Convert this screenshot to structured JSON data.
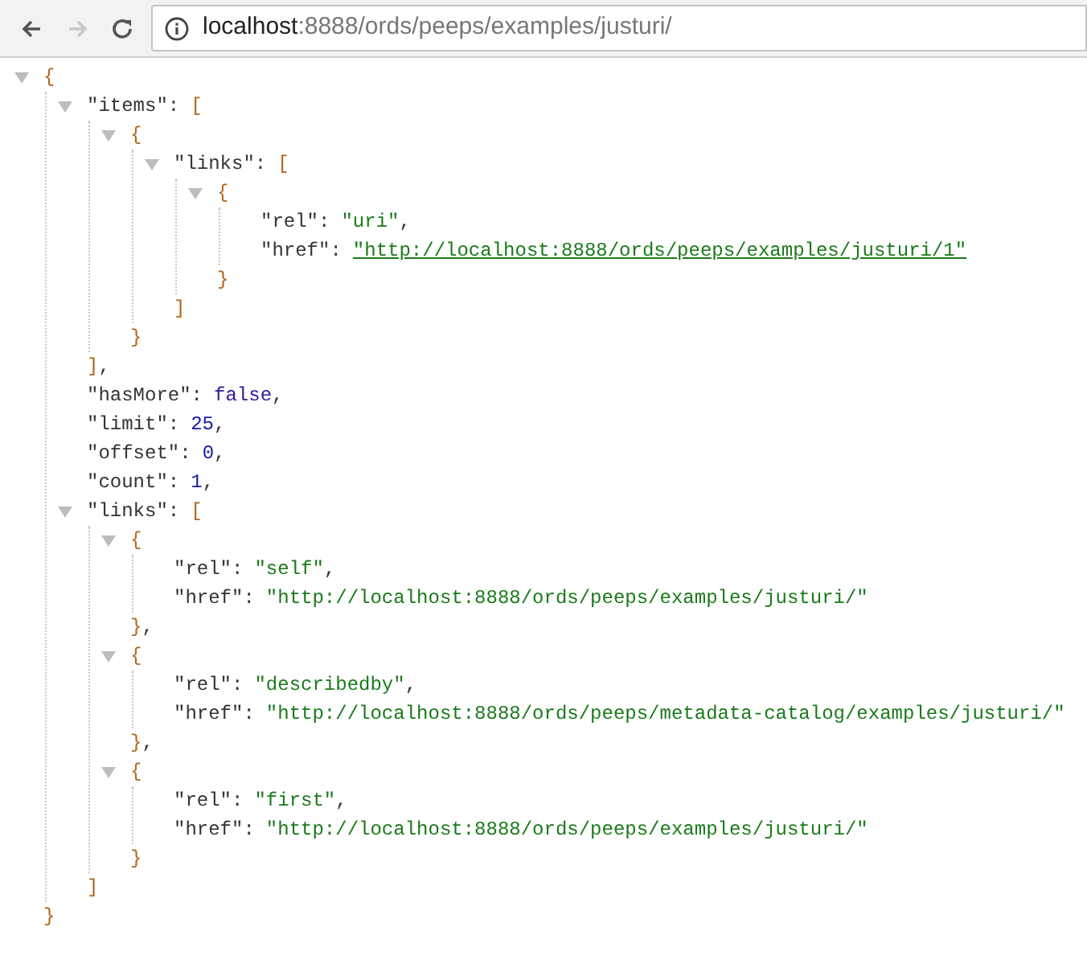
{
  "toolbar": {
    "back_enabled": true,
    "forward_enabled": false,
    "url_host": "localhost",
    "url_rest": ":8888/ords/peeps/examples/justuri/"
  },
  "tree": {
    "open": "{",
    "close": "}",
    "expanded": true,
    "children": [
      {
        "key": "\"items\":",
        "open": "[",
        "close": "]",
        "tail": ",",
        "expanded": true,
        "children": [
          {
            "open": "{",
            "close": "}",
            "expanded": true,
            "children": [
              {
                "key": "\"links\":",
                "open": "[",
                "close": "]",
                "expanded": true,
                "children": [
                  {
                    "open": "{",
                    "close": "}",
                    "expanded": true,
                    "children": [
                      {
                        "key": "\"rel\":",
                        "value": "\"uri\"",
                        "kind": "string",
                        "tail": ","
                      },
                      {
                        "key": "\"href\":",
                        "value": "\"http://localhost:8888/ords/peeps/examples/justuri/1\"",
                        "kind": "link"
                      }
                    ]
                  }
                ]
              }
            ]
          }
        ]
      },
      {
        "key": "\"hasMore\":",
        "value": "false",
        "kind": "boolean",
        "tail": ","
      },
      {
        "key": "\"limit\":",
        "value": "25",
        "kind": "number",
        "tail": ","
      },
      {
        "key": "\"offset\":",
        "value": "0",
        "kind": "number",
        "tail": ","
      },
      {
        "key": "\"count\":",
        "value": "1",
        "kind": "number",
        "tail": ","
      },
      {
        "key": "\"links\":",
        "open": "[",
        "close": "]",
        "expanded": true,
        "children": [
          {
            "open": "{",
            "close": "}",
            "tail": ",",
            "expanded": true,
            "children": [
              {
                "key": "\"rel\":",
                "value": "\"self\"",
                "kind": "string",
                "tail": ","
              },
              {
                "key": "\"href\":",
                "value": "\"http://localhost:8888/ords/peeps/examples/justuri/\"",
                "kind": "string"
              }
            ]
          },
          {
            "open": "{",
            "close": "}",
            "tail": ",",
            "expanded": true,
            "children": [
              {
                "key": "\"rel\":",
                "value": "\"describedby\"",
                "kind": "string",
                "tail": ","
              },
              {
                "key": "\"href\":",
                "value": "\"http://localhost:8888/ords/peeps/metadata-catalog/examples/justuri/\"",
                "kind": "string"
              }
            ]
          },
          {
            "open": "{",
            "close": "}",
            "expanded": true,
            "children": [
              {
                "key": "\"rel\":",
                "value": "\"first\"",
                "kind": "string",
                "tail": ","
              },
              {
                "key": "\"href\":",
                "value": "\"http://localhost:8888/ords/peeps/examples/justuri/\"",
                "kind": "string"
              }
            ]
          }
        ]
      }
    ]
  }
}
